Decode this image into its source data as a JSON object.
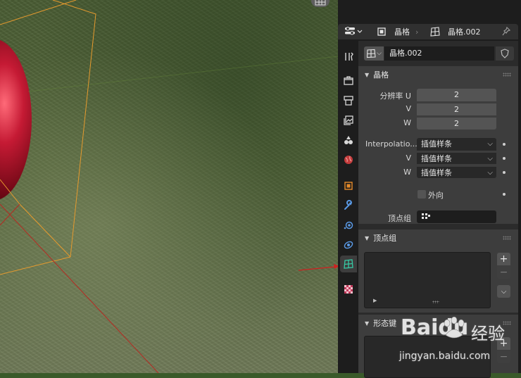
{
  "header": {
    "object_name": "晶格",
    "data_name": "晶格.002",
    "icons": [
      "editor-type-icon",
      "object-icon",
      "lattice-data-icon",
      "pin-icon"
    ]
  },
  "datablock": {
    "name": "晶格.002"
  },
  "lattice_panel": {
    "title": "晶格",
    "resolution_u_label": "分辨率 U",
    "resolution_u": "2",
    "v_label": "V",
    "resolution_v": "2",
    "w_label": "W",
    "resolution_w": "2",
    "interp_label": "Interpolatio...",
    "interp_u": "插值样条",
    "interp_v": "插值样条",
    "interp_w": "插值样条",
    "outside_label": "外向",
    "vertex_group_label": "顶点组"
  },
  "vertex_groups_panel": {
    "title": "顶点组",
    "add": "+",
    "remove": "−"
  },
  "shape_keys_panel": {
    "title": "形态键",
    "add": "+",
    "remove": "−"
  },
  "tabs": [
    "tool",
    "render",
    "output",
    "view-layer",
    "scene",
    "world",
    "object",
    "modifiers",
    "particles",
    "physics",
    "lattice-data",
    "texture"
  ],
  "active_tab": "lattice-data",
  "colors": {
    "lattice_wire": "#e69a2e",
    "active_tab_icon": "#37c9a4",
    "accent_red": "#c0302a"
  },
  "watermark": {
    "brand": "Baidu",
    "cn": "经验",
    "url": "jingyan.baidu.com"
  }
}
